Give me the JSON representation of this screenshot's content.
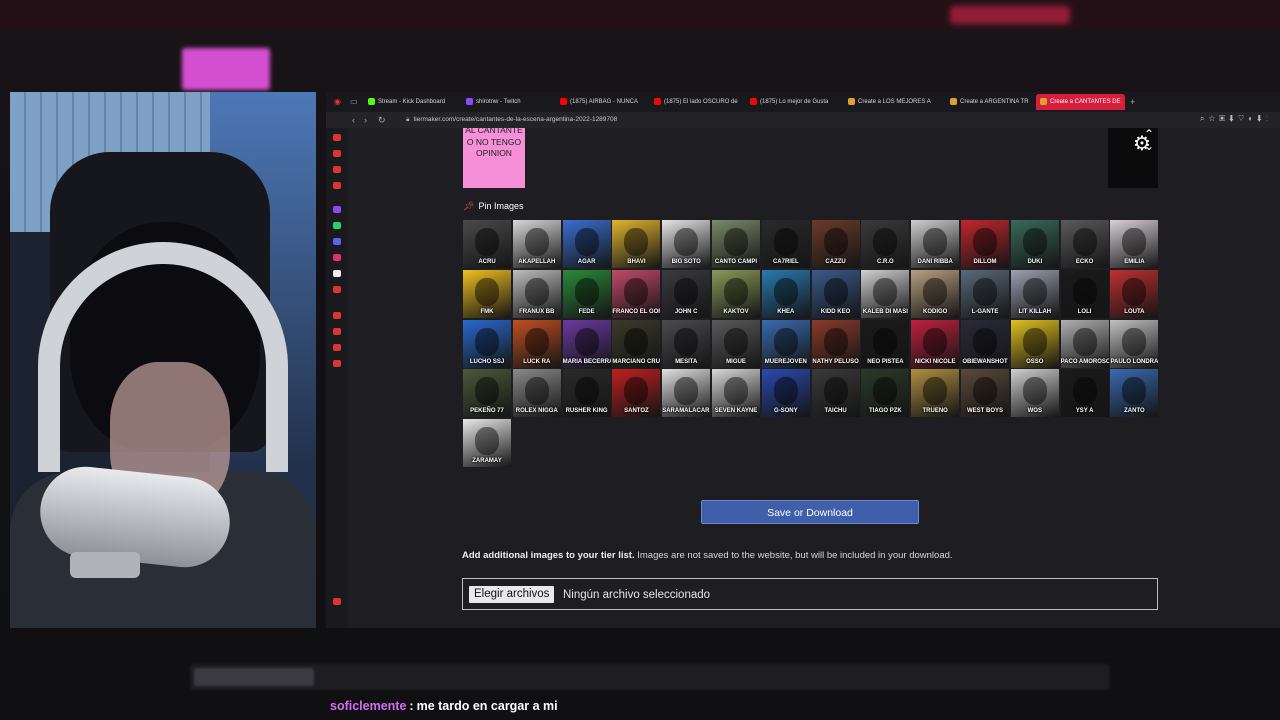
{
  "browser": {
    "tabs": [
      {
        "label": "Stream - Kick Dashboard",
        "icon": "kick-icon",
        "color": "#53fc18"
      },
      {
        "label": "shirotnw - Twitch",
        "icon": "twitch-icon",
        "color": "#9146ff"
      },
      {
        "label": "(1875) AIRBAG - NUNCA",
        "icon": "youtube-icon",
        "color": "#ff0000"
      },
      {
        "label": "(1875) El lado OSCURO de",
        "icon": "youtube-icon",
        "color": "#ff0000"
      },
      {
        "label": "(1875) Lo mejor de Gusta",
        "icon": "youtube-icon",
        "color": "#ff0000"
      },
      {
        "label": "Create a LOS MEJORES A",
        "icon": "tiermaker-icon",
        "color": "#e0a030"
      },
      {
        "label": "Create a ARGENTINA TR",
        "icon": "tiermaker-icon",
        "color": "#e0a030"
      },
      {
        "label": "Create a CANTANTES DE",
        "icon": "tiermaker-icon",
        "color": "#e0a030",
        "active": true
      }
    ],
    "url": "tiermaker.com/create/cantantes-de-la-escena-argentina-2022-1289708"
  },
  "tier": {
    "pink_row_label": "AL CANTANTE O NO TENGO OPINION",
    "pink_color": "#f48fd8"
  },
  "pin_images_label": "Pin Images",
  "artists": [
    {
      "name": "ACRU",
      "bg": "#4a4a4a"
    },
    {
      "name": "AKAPELLAH",
      "bg": "#d8d8d8"
    },
    {
      "name": "AGAR",
      "bg": "#3b6fd0"
    },
    {
      "name": "BHAVI",
      "bg": "#e0b530"
    },
    {
      "name": "BIG SOTO",
      "bg": "#e6e6e6"
    },
    {
      "name": "CANTO CAMPI",
      "bg": "#7a8a6a"
    },
    {
      "name": "CA7RIEL",
      "bg": "#2a2a2a"
    },
    {
      "name": "CAZZU",
      "bg": "#6a3b2a"
    },
    {
      "name": "C.R.O",
      "bg": "#3a3a3a"
    },
    {
      "name": "DANI RIBBA",
      "bg": "#cfcfcf"
    },
    {
      "name": "DILLOM",
      "bg": "#c0272d"
    },
    {
      "name": "DUKI",
      "bg": "#3a6a5a"
    },
    {
      "name": "ECKO",
      "bg": "#5a5a5a"
    },
    {
      "name": "EMILIA",
      "bg": "#d9d0d6"
    },
    {
      "name": "FMK",
      "bg": "#f0c020"
    },
    {
      "name": "FRANUX BB",
      "bg": "#bdbdbd"
    },
    {
      "name": "FEDE",
      "bg": "#2a8a3a"
    },
    {
      "name": "FRANCO EL GORGO",
      "bg": "#c14a6a"
    },
    {
      "name": "JOHN C",
      "bg": "#3a3a40"
    },
    {
      "name": "KAKTOV",
      "bg": "#8a9a5a"
    },
    {
      "name": "KHEA",
      "bg": "#2a7ab0"
    },
    {
      "name": "KIDD KEO",
      "bg": "#3a5a8a"
    },
    {
      "name": "KALEB DI MASI",
      "bg": "#d0d0d0"
    },
    {
      "name": "KODIGO",
      "bg": "#b8a080"
    },
    {
      "name": "L-GANTE",
      "bg": "#5a6a7a"
    },
    {
      "name": "LIT KILLAH",
      "bg": "#9aa0b0"
    },
    {
      "name": "LOLI",
      "bg": "#1a1a1a"
    },
    {
      "name": "LOUTA",
      "bg": "#c03030"
    },
    {
      "name": "LUCHO SSJ",
      "bg": "#2a6ad0"
    },
    {
      "name": "LUCK RA",
      "bg": "#c05020"
    },
    {
      "name": "MARIA BECERRA",
      "bg": "#6a3aa0"
    },
    {
      "name": "MARCIANO CRUZ",
      "bg": "#3a3a2a"
    },
    {
      "name": "MESITA",
      "bg": "#4a4a50"
    },
    {
      "name": "MIGUE",
      "bg": "#5a5a5a"
    },
    {
      "name": "MUEREJOVEN",
      "bg": "#3a6ab0"
    },
    {
      "name": "NATHY PELUSO",
      "bg": "#8a3a2a"
    },
    {
      "name": "NEO PISTEA",
      "bg": "#1a1a1a"
    },
    {
      "name": "NICKI NICOLE",
      "bg": "#c02040"
    },
    {
      "name": "OBIEWANSHOT",
      "bg": "#2a2a3a"
    },
    {
      "name": "OSSO",
      "bg": "#e0c020"
    },
    {
      "name": "PACO AMOROSO",
      "bg": "#b0b0b0"
    },
    {
      "name": "PAULO LONDRA",
      "bg": "#c0c0c0"
    },
    {
      "name": "PEKEÑO 77",
      "bg": "#4a5a3a"
    },
    {
      "name": "ROLEX NIGGA",
      "bg": "#8a8a8a"
    },
    {
      "name": "RUSHER KING",
      "bg": "#2a2a2a"
    },
    {
      "name": "SANTOZ",
      "bg": "#c02020"
    },
    {
      "name": "SARAMALACARA",
      "bg": "#e0e0e0"
    },
    {
      "name": "SEVEN KAYNE",
      "bg": "#d8d8d8"
    },
    {
      "name": "G-SONY",
      "bg": "#2a4ab0"
    },
    {
      "name": "TAICHU",
      "bg": "#3a3a3a"
    },
    {
      "name": "TIAGO PZK",
      "bg": "#2a3a2a"
    },
    {
      "name": "TRUENO",
      "bg": "#b09040"
    },
    {
      "name": "WEST BOYS",
      "bg": "#5a4a3a"
    },
    {
      "name": "WOS",
      "bg": "#d0d0d0"
    },
    {
      "name": "YSY A",
      "bg": "#1a1a1a"
    },
    {
      "name": "ZANTO",
      "bg": "#3a6ab0"
    },
    {
      "name": "ZARAMAY",
      "bg": "#e8e8e8"
    }
  ],
  "save_button_label": "Save or Download",
  "additional": {
    "bold": "Add additional images to your tier list.",
    "rest": " Images are not saved to the website, but will be included in your download."
  },
  "file_input": {
    "button_label": "Elegir archivos",
    "status": "Ningún archivo seleccionado"
  },
  "chat": {
    "user": "soficlemente",
    "separator": ":",
    "message": "me tardo en cargar a mi"
  }
}
